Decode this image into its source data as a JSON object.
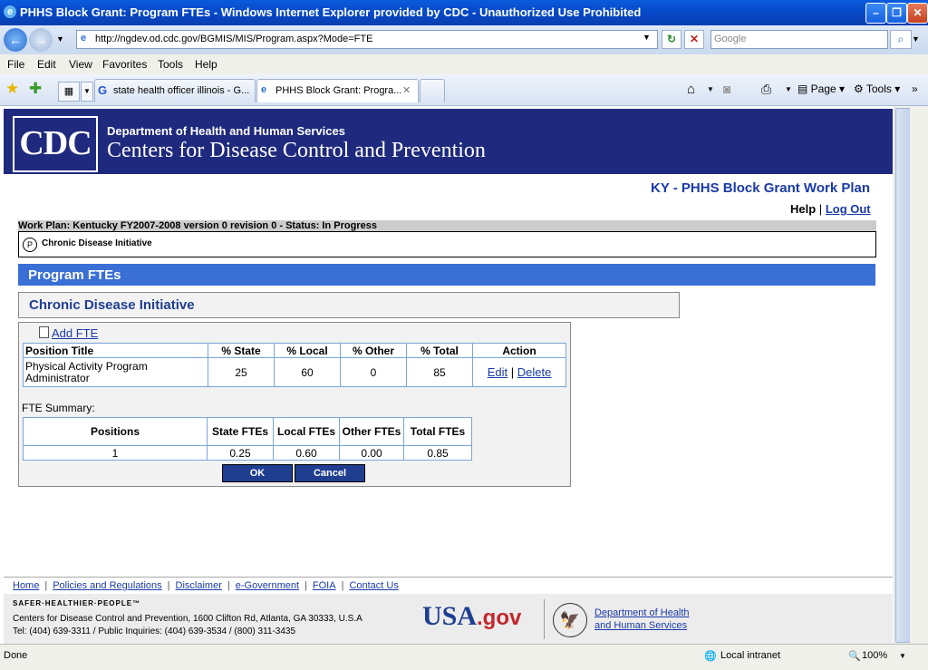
{
  "window": {
    "title": "PHHS Block Grant: Program FTEs - Windows Internet Explorer provided by CDC - Unauthorized Use Prohibited",
    "ie_glyph": "e"
  },
  "addressbar": {
    "url": "http://ngdev.od.cdc.gov/BGMIS/MIS/Program.aspx?Mode=FTE",
    "search_placeholder": "Google"
  },
  "menu": [
    "File",
    "Edit",
    "View",
    "Favorites",
    "Tools",
    "Help"
  ],
  "tabs": [
    {
      "label": "state health officer illinois - G..."
    },
    {
      "label": "PHHS Block Grant: Progra..."
    }
  ],
  "toolbar": {
    "page_label": "Page",
    "tools_label": "Tools"
  },
  "header": {
    "logo_text": "CDC",
    "department": "Department of Health and Human Services",
    "agency": "Centers for Disease Control and Prevention"
  },
  "site": {
    "title": "KY - PHHS Block Grant Work Plan",
    "help": "Help",
    "logout": "Log Out",
    "separator": "|"
  },
  "workplan": {
    "status_line": "Work Plan: Kentucky FY2007-2008 version 0 revision 0 - Status: In Progress",
    "program_badge": "P",
    "program_name": "Chronic Disease Initiative"
  },
  "section": {
    "title": "Program FTEs",
    "program": "Chronic Disease Initiative"
  },
  "fte": {
    "add_label": "Add FTE",
    "headers": [
      "Position Title",
      "% State",
      "% Local",
      "% Other",
      "% Total",
      "Action"
    ],
    "rows": [
      {
        "title": "Physical Activity Program Administrator",
        "state": "25",
        "local": "60",
        "other": "0",
        "total": "85",
        "edit": "Edit",
        "sep": "|",
        "delete": "Delete"
      }
    ],
    "summary_label": "FTE Summary:",
    "summary_headers": [
      "Positions",
      "State FTEs",
      "Local FTEs",
      "Other FTEs",
      "Total FTEs"
    ],
    "summary_values": [
      "1",
      "0.25",
      "0.60",
      "0.00",
      "0.85"
    ],
    "ok_label": "OK",
    "cancel_label": "Cancel"
  },
  "footer": {
    "links": [
      "Home",
      "Policies and Regulations",
      "Disclaimer",
      "e-Government",
      "FOIA",
      "Contact Us"
    ],
    "separator": "|",
    "tagline": "SAFER·HEALTHIER·PEOPLE™",
    "address": "Centers for Disease Control and Prevention, 1600 Clifton Rd, Atlanta, GA 30333, U.S.A",
    "phones": "Tel: (404) 639-3311 / Public Inquiries: (404) 639-3534 / (800) 311-3435",
    "usa_main": "USA",
    "usa_gov": ".gov",
    "hhs_line1": "Department of Health",
    "hhs_line2": "and Human Services"
  },
  "status": {
    "left": "Done",
    "zone": "Local intranet",
    "zoom": "100%"
  },
  "colors": {
    "cdc_navy": "#1f2a7e",
    "section_blue": "#3a6fd6",
    "link_blue": "#1a3aa8"
  }
}
